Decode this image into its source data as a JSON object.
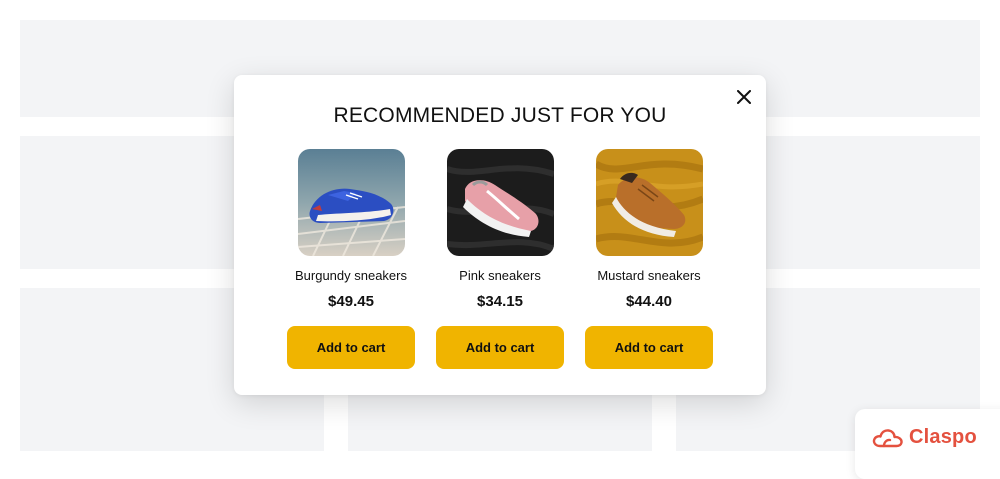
{
  "popup": {
    "title": "RECOMMENDED JUST FOR YOU",
    "close_icon": "close-icon"
  },
  "products": [
    {
      "name": "Burgundy sneakers",
      "price": "$49.45",
      "button_label": "Add to cart",
      "image": "blue-sneaker-on-net"
    },
    {
      "name": "Pink sneakers",
      "price": "$34.15",
      "button_label": "Add to cart",
      "image": "pink-sneaker-on-dark-fabric"
    },
    {
      "name": "Mustard sneakers",
      "price": "$44.40",
      "button_label": "Add to cart",
      "image": "brown-sneaker-on-mustard-fabric"
    }
  ],
  "brand": {
    "name": "Claspo",
    "icon": "cloud-logo-icon"
  },
  "colors": {
    "accent": "#f0b400",
    "brand": "#e4513f",
    "placeholder": "#f3f4f6"
  }
}
